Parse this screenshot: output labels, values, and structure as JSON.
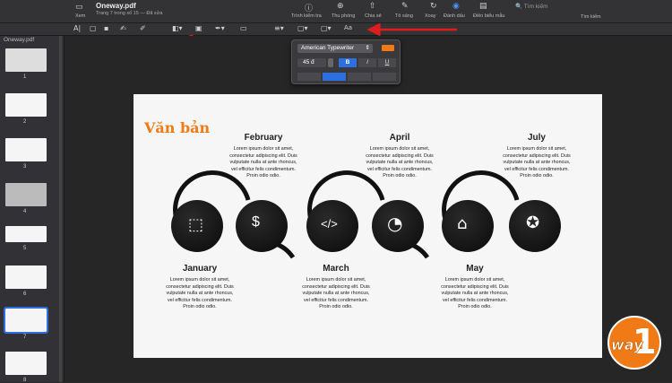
{
  "window": {
    "title": "Oneway.pdf",
    "subtitle": "Trang 7 trong số 15 — Đã sửa",
    "view_label": "Xem"
  },
  "toolbar": {
    "items": [
      "Trình kiểm tra",
      "Thu phóng",
      "Chia sẻ",
      "Tô sáng",
      "Xoay",
      "Đánh dấu",
      "Điền biểu mẫu"
    ],
    "search_placeholder": "Tìm kiếm",
    "search_label": "Tìm kiếm",
    "font_menu_label": "Aa"
  },
  "sidebar": {
    "title": "Oneway.pdf",
    "pages": [
      "1",
      "2",
      "3",
      "4",
      "5",
      "6",
      "7",
      "8"
    ]
  },
  "text_popup": {
    "font": "American Typewriter",
    "size": "45 đ",
    "bold": "B",
    "italic": "I",
    "underline": "U",
    "color": "#f07b16"
  },
  "slide": {
    "heading": "Văn bản",
    "body_text": "Lorem ipsum dolor sit amet, consectetur adipiscing elit. Duis vulputate nulla at ante rhoncus, vel efficitur felis condimentum. Proin odio odio.",
    "months": [
      "January",
      "February",
      "March",
      "April",
      "May",
      "July"
    ]
  },
  "brand": {
    "logo_text": "way",
    "logo_number": "1",
    "accent": "#f07b16"
  }
}
